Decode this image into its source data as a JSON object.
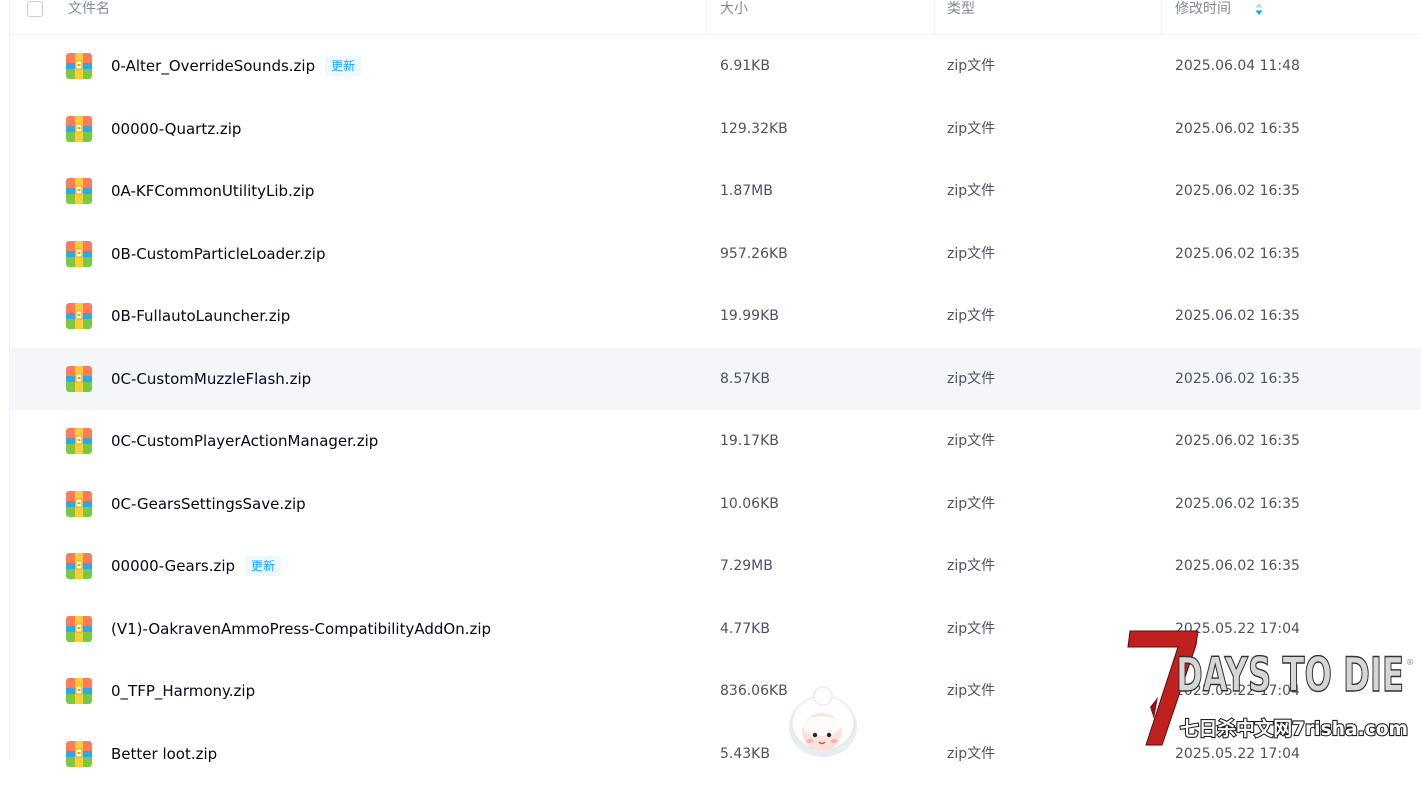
{
  "header": {
    "name_label": "文件名",
    "size_label": "大小",
    "type_label": "类型",
    "modified_label": "修改时间",
    "sort_icon": "sort-desc-icon"
  },
  "badge_label": "更新",
  "files": [
    {
      "name": "0-Alter_OverrideSounds.zip",
      "badge": "更新",
      "size": "6.91KB",
      "type": "zip文件",
      "modified": "2025.06.04 11:48"
    },
    {
      "name": "00000-Quartz.zip",
      "badge": "",
      "size": "129.32KB",
      "type": "zip文件",
      "modified": "2025.06.02 16:35"
    },
    {
      "name": "0A-KFCommonUtilityLib.zip",
      "badge": "",
      "size": "1.87MB",
      "type": "zip文件",
      "modified": "2025.06.02 16:35"
    },
    {
      "name": "0B-CustomParticleLoader.zip",
      "badge": "",
      "size": "957.26KB",
      "type": "zip文件",
      "modified": "2025.06.02 16:35"
    },
    {
      "name": "0B-FullautoLauncher.zip",
      "badge": "",
      "size": "19.99KB",
      "type": "zip文件",
      "modified": "2025.06.02 16:35"
    },
    {
      "name": "0C-CustomMuzzleFlash.zip",
      "badge": "",
      "size": "8.57KB",
      "type": "zip文件",
      "modified": "2025.06.02 16:35"
    },
    {
      "name": "0C-CustomPlayerActionManager.zip",
      "badge": "",
      "size": "19.17KB",
      "type": "zip文件",
      "modified": "2025.06.02 16:35"
    },
    {
      "name": "0C-GearsSettingsSave.zip",
      "badge": "",
      "size": "10.06KB",
      "type": "zip文件",
      "modified": "2025.06.02 16:35"
    },
    {
      "name": "00000-Gears.zip",
      "badge": "更新",
      "size": "7.29MB",
      "type": "zip文件",
      "modified": "2025.06.02 16:35"
    },
    {
      "name": "(V1)-OakravenAmmoPress-CompatibilityAddOn.zip",
      "badge": "",
      "size": "4.77KB",
      "type": "zip文件",
      "modified": "2025.05.22 17:04"
    },
    {
      "name": "0_TFP_Harmony.zip",
      "badge": "",
      "size": "836.06KB",
      "type": "zip文件",
      "modified": "2025.05.22 17:04"
    },
    {
      "name": "Better loot.zip",
      "badge": "",
      "size": "5.43KB",
      "type": "zip文件",
      "modified": "2025.05.22 17:04"
    }
  ],
  "hovered_row": 5,
  "watermark": {
    "logo_text": "DAYS TO DIE",
    "numeral": "7",
    "site_text": "七日杀中文网7risha.com"
  },
  "colors": {
    "accent": "#06a7ff",
    "header_text": "#818999",
    "row_hover": "#f5f6f9",
    "watermark_red": "#c0211f"
  }
}
